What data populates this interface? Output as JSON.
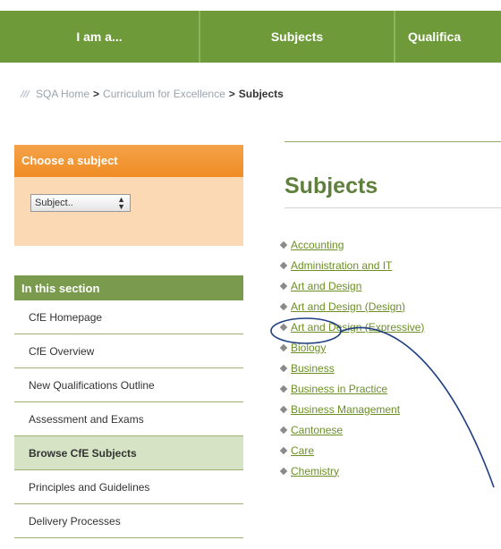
{
  "topnav": {
    "tabs": [
      "I am a...",
      "Subjects",
      "Qualifica"
    ]
  },
  "breadcrumb": {
    "home": "SQA Home",
    "separator": ">",
    "cfe": "Curriculum for Excellence",
    "current": "Subjects"
  },
  "choose": {
    "heading": "Choose a subject",
    "select_value": "Subject.."
  },
  "section": {
    "heading": "In this section",
    "items": [
      "CfE Homepage",
      "CfE Overview",
      "New Qualifications Outline",
      "Assessment and Exams",
      "Browse CfE Subjects",
      "Principles and Guidelines",
      "Delivery Processes"
    ],
    "active_index": 4
  },
  "main": {
    "title": "Subjects",
    "subjects": [
      "Accounting",
      "Administration and IT",
      "Art and Design",
      "Art and Design (Design)",
      "Art and Design (Expressive)",
      "Biology",
      "Business",
      "Business in Practice",
      "Business Management",
      "Cantonese",
      "Care",
      "Chemistry"
    ],
    "highlighted": "Biology"
  },
  "colors": {
    "nav_green": "#6f9a3a",
    "link_green": "#6c8f26",
    "title_green": "#5f7f3c",
    "orange": "#ef8c23",
    "annotation": "#1f3f80"
  }
}
